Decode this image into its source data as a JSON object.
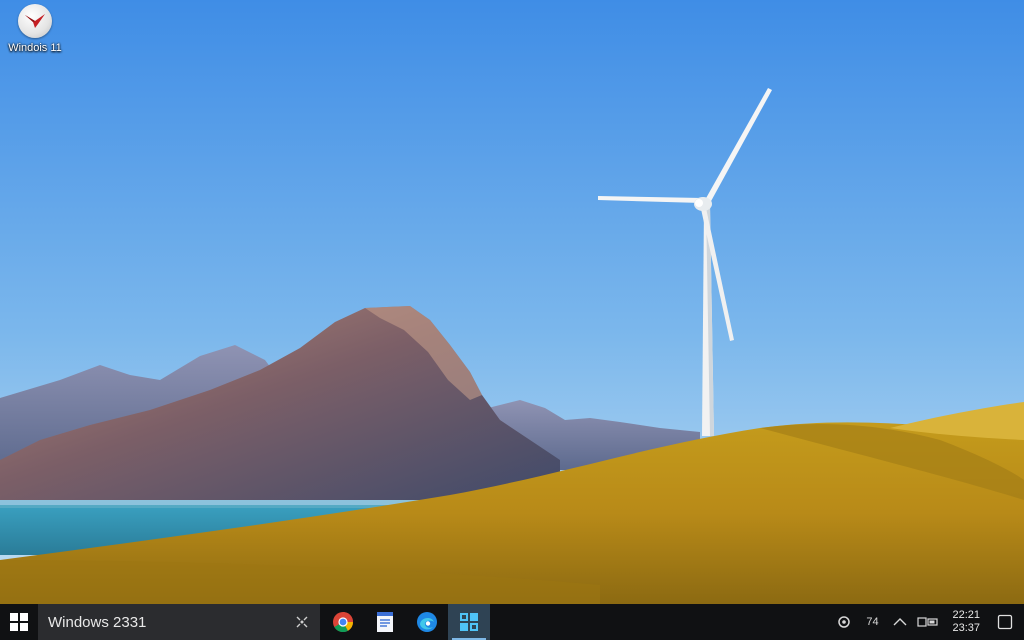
{
  "desktop": {
    "icons": [
      {
        "label": "Windois 11",
        "icon": "app-logo-icon"
      }
    ]
  },
  "taskbar": {
    "start_icon": "windows-logo-icon",
    "search": {
      "text": "Windows 2331",
      "mic_icon": "microphone-icon"
    },
    "apps": [
      {
        "name": "chrome",
        "icon": "chrome-icon",
        "active": false
      },
      {
        "name": "document",
        "icon": "document-icon",
        "active": false
      },
      {
        "name": "edge",
        "icon": "edge-icon",
        "active": false
      },
      {
        "name": "store",
        "icon": "store-icon",
        "active": true
      }
    ],
    "tray": {
      "items": [
        {
          "icon": "settings-icon",
          "text": ""
        },
        {
          "icon": "",
          "text": "74"
        },
        {
          "icon": "wifi-icon",
          "text": ""
        },
        {
          "icon": "battery-icon",
          "text": ""
        }
      ],
      "clock": {
        "time": "22:21",
        "date": "23:37"
      },
      "notification_icon": "notification-icon"
    }
  },
  "colors": {
    "sky_top": "#3f8de6",
    "sky_bottom": "#b9dcf2",
    "hill": "#c8a01f",
    "lake": "#3d97b8",
    "taskbar": "#101113",
    "search_bg": "#2b2c2f",
    "accent": "#7fb8e6"
  }
}
